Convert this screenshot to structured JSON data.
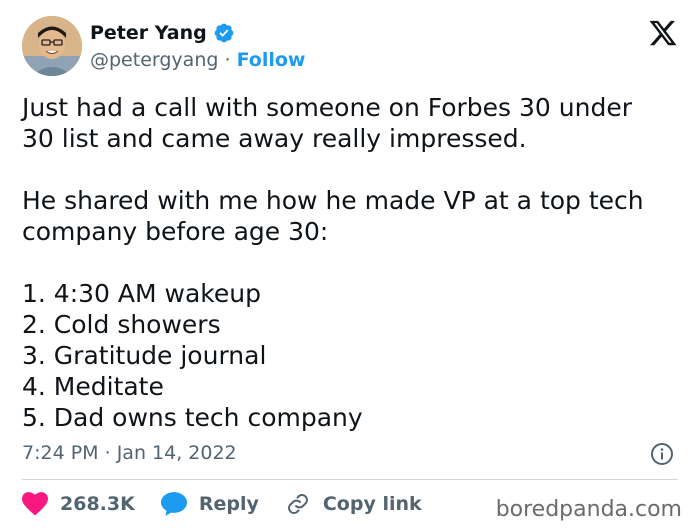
{
  "author": {
    "name": "Peter Yang",
    "handle": "@petergyang",
    "separator": "·",
    "follow_label": "Follow"
  },
  "tweet": {
    "text": "Just had a call with someone on Forbes 30 under\n30 list and came away really impressed.\n\nHe shared with me how he made VP at a top tech\ncompany before age 30:\n\n1. 4:30 AM wakeup\n2. Cold showers\n3. Gratitude journal\n4. Meditate\n5. Dad owns tech company",
    "time": "7:24 PM",
    "date_separator": "·",
    "date": "Jan 14, 2022"
  },
  "actions": {
    "like_count": "268.3K",
    "reply_label": "Reply",
    "copy_link_label": "Copy link"
  },
  "watermark": "boredpanda.com",
  "colors": {
    "accent": "#1d9bf0",
    "like": "#f91880",
    "text": "#0f1419",
    "muted": "#536471"
  }
}
